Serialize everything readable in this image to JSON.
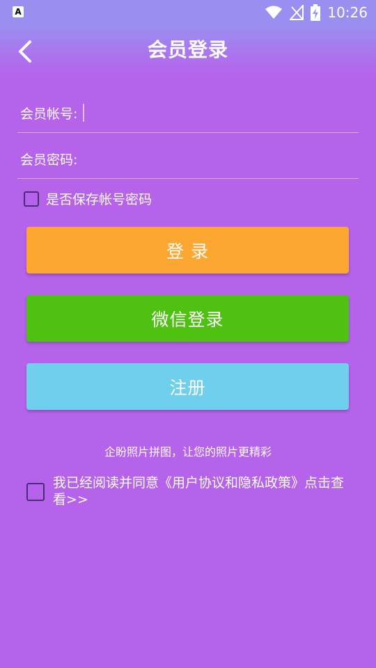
{
  "status_bar": {
    "left_icon": "A",
    "time": "10:26",
    "icons": [
      "wifi-icon",
      "signal-off-icon",
      "battery-charging-icon"
    ]
  },
  "app_bar": {
    "title": "会员登录",
    "back_icon": "chevron-left-icon"
  },
  "form": {
    "account_label": "会员帐号:",
    "account_value": "",
    "password_label": "会员密码:",
    "password_value": "",
    "remember_label": "是否保存帐号密码",
    "remember_checked": false
  },
  "buttons": {
    "login": "登 录",
    "wechat_login": "微信登录",
    "register": "注册"
  },
  "colors": {
    "background": "#b663ec",
    "login": "#fda733",
    "wechat": "#4fc112",
    "register": "#6fcfed"
  },
  "slogan": "企盼照片拼图，让您的照片更精彩",
  "agreement": {
    "text": "我已经阅读并同意《用户协议和隐私政策》点击查看>>",
    "checked": false
  }
}
